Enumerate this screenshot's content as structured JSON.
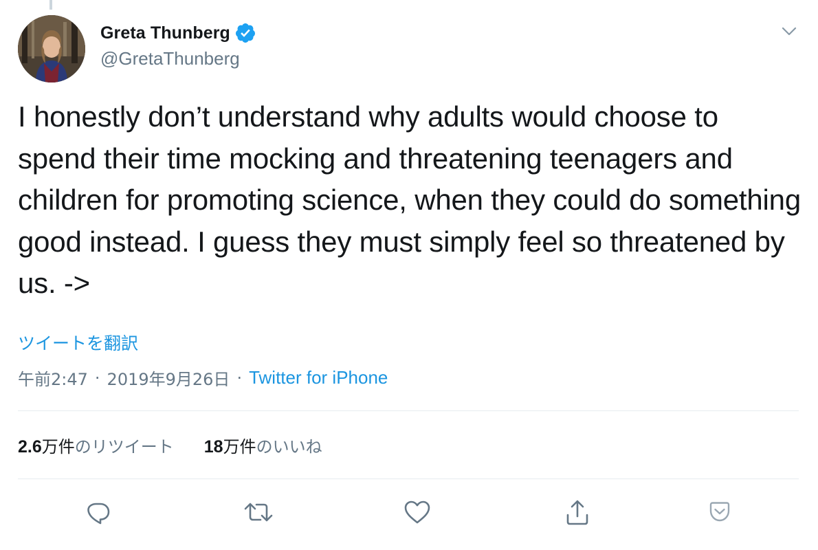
{
  "author": {
    "display_name": "Greta Thunberg",
    "handle": "@GretaThunberg",
    "verified": true
  },
  "tweet": {
    "text": "I honestly don’t understand why adults would choose to spend their time mocking and threatening teenagers and children for promoting science, when they could do something good instead. I guess they must simply feel so threatened by us. ->",
    "translate_label": "ツイートを翻訳",
    "time": "午前2:47",
    "date": "2019年9月26日",
    "separator": "·",
    "source": "Twitter for iPhone"
  },
  "stats": {
    "retweets": {
      "count": "2.6",
      "unit": "万件",
      "label": "のリツイート"
    },
    "likes": {
      "count": "18",
      "unit": "万件",
      "label": "のいいね"
    }
  },
  "icons": {
    "menu": "chevron-down-icon",
    "reply": "reply-icon",
    "retweet": "retweet-icon",
    "like": "heart-icon",
    "share": "share-icon",
    "bookmark": "pocket-save-icon",
    "verified": "verified-badge-icon"
  },
  "colors": {
    "text": "#14171a",
    "secondary": "#657786",
    "link": "#1b95e0",
    "verified": "#1da1f2",
    "icon": "#657786",
    "pocket": "#9aa7b2"
  }
}
